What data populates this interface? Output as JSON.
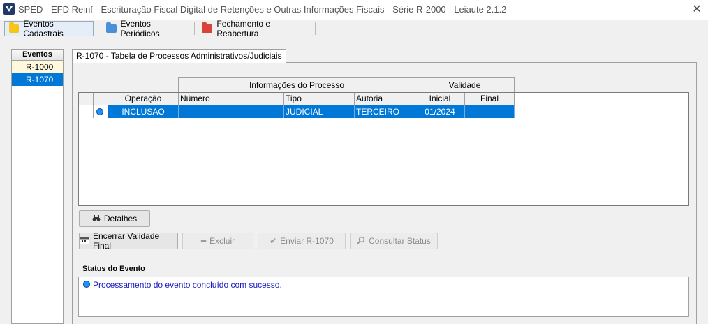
{
  "window": {
    "title": "SPED - EFD Reinf - Escrituração Fiscal Digital de Retenções e Outras Informações Fiscais - Série R-2000 - Leiaute 2.1.2",
    "close_glyph": "✕"
  },
  "toolbar": {
    "tabs": [
      {
        "label": "Eventos Cadastrais",
        "icon": "yellow-folder-icon",
        "color": "#f5c518"
      },
      {
        "label": "Eventos Periódicos",
        "icon": "blue-folder-icon",
        "color": "#4a90d9"
      },
      {
        "label": "Fechamento e Reabertura",
        "icon": "red-folder-icon",
        "color": "#d9443a"
      }
    ]
  },
  "sidebar": {
    "header": "Eventos",
    "items": [
      {
        "label": "R-1000"
      },
      {
        "label": "R-1070"
      }
    ]
  },
  "panel": {
    "tab_label": "R-1070 - Tabela de Processos Administrativos/Judiciais"
  },
  "grid": {
    "group_headers": {
      "info": "Informações do Processo",
      "validity": "Validade"
    },
    "columns": [
      "Operação",
      "Número",
      "Tipo",
      "Autoria",
      "Inicial",
      "Final"
    ],
    "rows": [
      {
        "operacao": "INCLUSAO",
        "numero": "",
        "tipo": "JUDICIAL",
        "autoria": "TERCEIRO",
        "inicial": "01/2024",
        "final": ""
      }
    ]
  },
  "buttons": {
    "detalhes": "Detalhes",
    "encerrar": "Encerrar Validade Final",
    "excluir": "Excluir",
    "enviar": "Enviar R-1070",
    "consultar": "Consultar Status"
  },
  "status": {
    "label": "Status do Evento",
    "message": "Processamento do evento concluído com sucesso."
  },
  "colors": {
    "selection": "#0078d7",
    "status_text": "#1a1ac0"
  }
}
